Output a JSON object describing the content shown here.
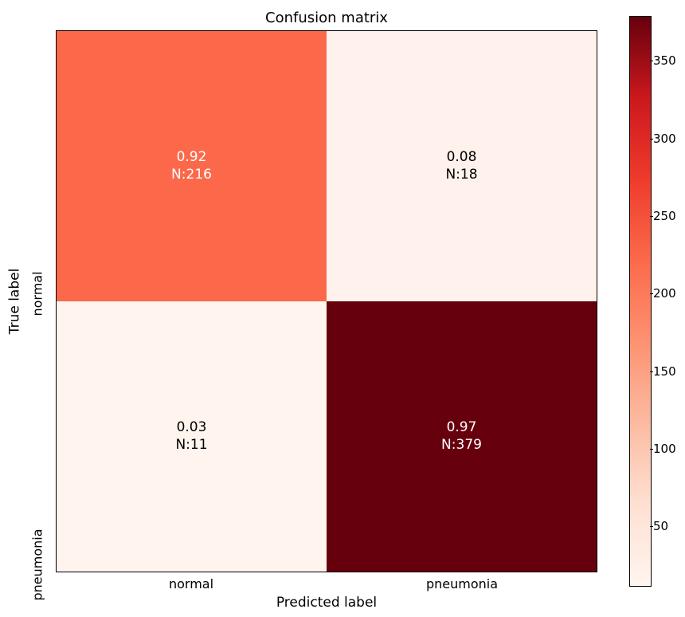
{
  "chart_data": {
    "type": "heatmap",
    "title": "Confusion matrix",
    "xlabel": "Predicted label",
    "ylabel": "True label",
    "x_categories": [
      "normal",
      "pneumonia"
    ],
    "y_categories": [
      "normal",
      "pneumonia"
    ],
    "cells": [
      [
        {
          "proportion": "0.92",
          "count": "216",
          "value_n": 216,
          "fill": "#fb694a",
          "text_color": "#ffffff"
        },
        {
          "proportion": "0.08",
          "count": "18",
          "value_n": 18,
          "fill": "#fff2ec",
          "text_color": "#000000"
        }
      ],
      [
        {
          "proportion": "0.03",
          "count": "11",
          "value_n": 11,
          "fill": "#fff4ee",
          "text_color": "#000000"
        },
        {
          "proportion": "0.97",
          "count": "379",
          "value_n": 379,
          "fill": "#67000d",
          "text_color": "#ffffff"
        }
      ]
    ],
    "colorbar": {
      "min": 11,
      "max": 379,
      "ticks": [
        {
          "value": 50,
          "label": "50"
        },
        {
          "value": 100,
          "label": "100"
        },
        {
          "value": 150,
          "label": "150"
        },
        {
          "value": 200,
          "label": "200"
        },
        {
          "value": 250,
          "label": "250"
        },
        {
          "value": 300,
          "label": "300"
        },
        {
          "value": 350,
          "label": "350"
        }
      ]
    }
  }
}
